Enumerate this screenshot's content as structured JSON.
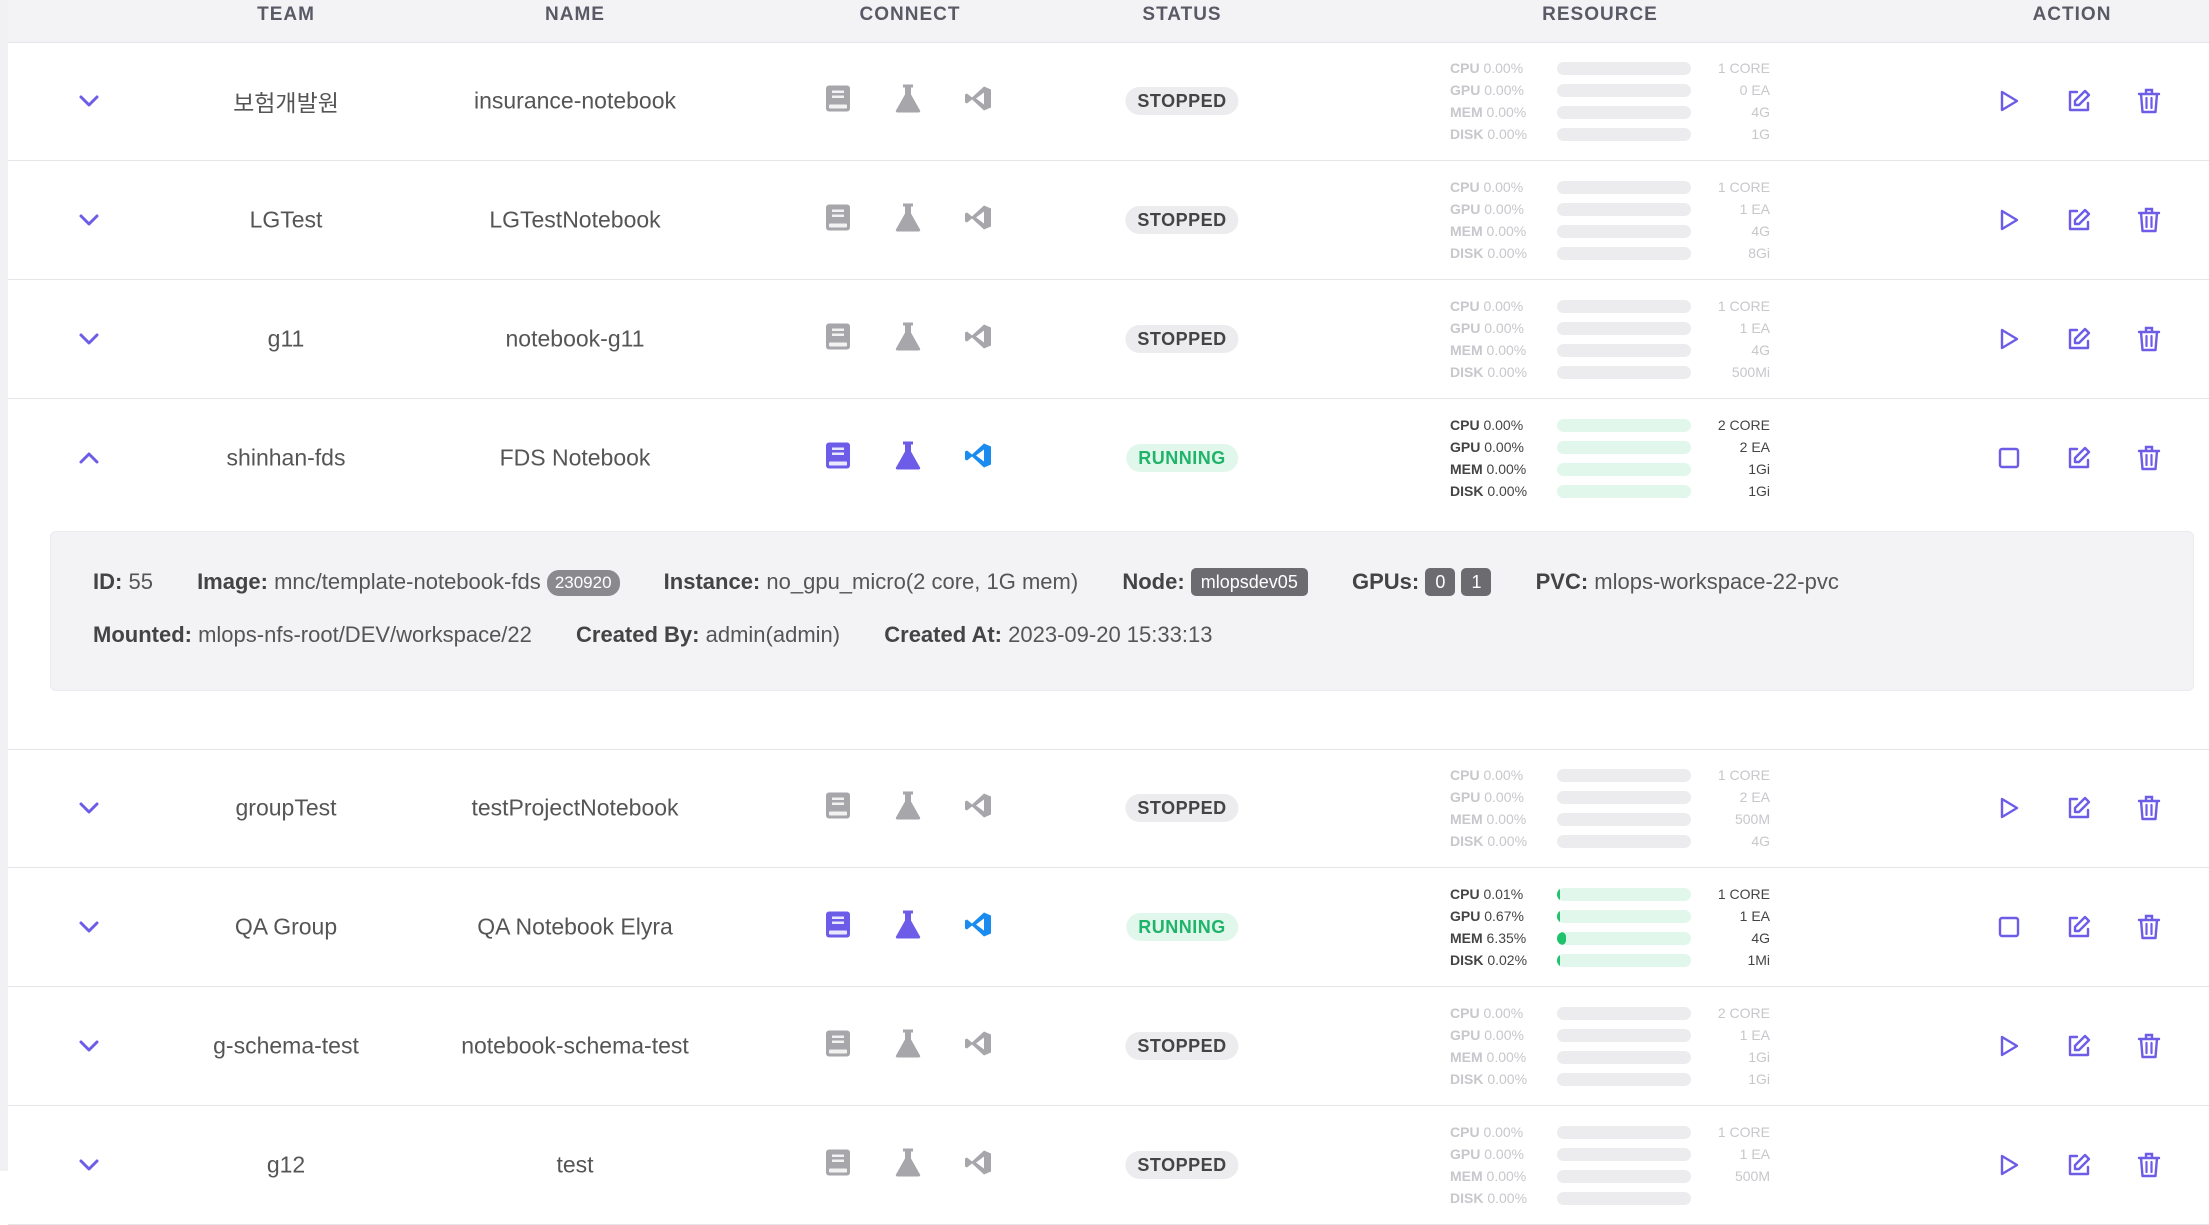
{
  "columns": {
    "team": "TEAM",
    "name": "NAME",
    "connect": "CONNECT",
    "status": "STATUS",
    "resource": "RESOURCE",
    "action": "ACTION"
  },
  "colors": {
    "accent": "#6c5ce7",
    "vscode": "#1a8cf0",
    "running": "#1fb46a",
    "muted": "#a6a6ab"
  },
  "rows": [
    {
      "team": "보험개발원",
      "name": "insurance-notebook",
      "status": "STOPPED",
      "expanded": false,
      "cpu": "CPU 0.00%",
      "gpu": "GPU 0.00%",
      "mem": "MEM 0.00%",
      "disk": "DISK 0.00%",
      "cpu_cap": "1 CORE",
      "gpu_cap": "0 EA",
      "mem_cap": "4G",
      "disk_cap": "1G",
      "cpu_usage": 0,
      "gpu_usage": 0,
      "mem_usage": 0,
      "disk_usage": 0
    },
    {
      "team": "LGTest",
      "name": "LGTestNotebook",
      "status": "STOPPED",
      "expanded": false,
      "cpu": "CPU 0.00%",
      "gpu": "GPU 0.00%",
      "mem": "MEM 0.00%",
      "disk": "DISK 0.00%",
      "cpu_cap": "1 CORE",
      "gpu_cap": "1 EA",
      "mem_cap": "4G",
      "disk_cap": "8Gi",
      "cpu_usage": 0,
      "gpu_usage": 0,
      "mem_usage": 0,
      "disk_usage": 0
    },
    {
      "team": "g11",
      "name": "notebook-g11",
      "status": "STOPPED",
      "expanded": false,
      "cpu": "CPU 0.00%",
      "gpu": "GPU 0.00%",
      "mem": "MEM 0.00%",
      "disk": "DISK 0.00%",
      "cpu_cap": "1 CORE",
      "gpu_cap": "1 EA",
      "mem_cap": "4G",
      "disk_cap": "500Mi",
      "cpu_usage": 0,
      "gpu_usage": 0,
      "mem_usage": 0,
      "disk_usage": 0
    },
    {
      "team": "shinhan-fds",
      "name": "FDS Notebook",
      "status": "RUNNING",
      "expanded": true,
      "cpu": "CPU 0.00%",
      "gpu": "GPU 0.00%",
      "mem": "MEM 0.00%",
      "disk": "DISK 0.00%",
      "cpu_cap": "2 CORE",
      "gpu_cap": "2 EA",
      "mem_cap": "1Gi",
      "disk_cap": "1Gi",
      "cpu_usage": 0,
      "gpu_usage": 0,
      "mem_usage": 0,
      "disk_usage": 0
    },
    {
      "team": "groupTest",
      "name": "testProjectNotebook",
      "status": "STOPPED",
      "expanded": false,
      "cpu": "CPU 0.00%",
      "gpu": "GPU 0.00%",
      "mem": "MEM 0.00%",
      "disk": "DISK 0.00%",
      "cpu_cap": "1 CORE",
      "gpu_cap": "2 EA",
      "mem_cap": "500M",
      "disk_cap": "4G",
      "cpu_usage": 0,
      "gpu_usage": 0,
      "mem_usage": 0,
      "disk_usage": 0
    },
    {
      "team": "QA Group",
      "name": "QA Notebook Elyra",
      "status": "RUNNING",
      "expanded": false,
      "cpu": "CPU 0.01%",
      "gpu": "GPU 0.67%",
      "mem": "MEM 6.35%",
      "disk": "DISK 0.02%",
      "cpu_cap": "1 CORE",
      "gpu_cap": "1 EA",
      "mem_cap": "4G",
      "disk_cap": "1Mi",
      "cpu_usage": 0.01,
      "gpu_usage": 0.67,
      "mem_usage": 6.35,
      "disk_usage": 0.02
    },
    {
      "team": "g-schema-test",
      "name": "notebook-schema-test",
      "status": "STOPPED",
      "expanded": false,
      "cpu": "CPU 0.00%",
      "gpu": "GPU 0.00%",
      "mem": "MEM 0.00%",
      "disk": "DISK 0.00%",
      "cpu_cap": "2 CORE",
      "gpu_cap": "1 EA",
      "mem_cap": "1Gi",
      "disk_cap": "1Gi",
      "cpu_usage": 0,
      "gpu_usage": 0,
      "mem_usage": 0,
      "disk_usage": 0
    },
    {
      "team": "g12",
      "name": "test",
      "status": "STOPPED",
      "expanded": false,
      "cpu": "CPU 0.00%",
      "gpu": "GPU 0.00%",
      "mem": "MEM 0.00%",
      "disk": "DISK 0.00%",
      "cpu_cap": "1 CORE",
      "gpu_cap": "1 EA",
      "mem_cap": "500M",
      "disk_cap": "",
      "cpu_usage": 0,
      "gpu_usage": 0,
      "mem_usage": 0,
      "disk_usage": 0
    }
  ],
  "detail": {
    "id_label": "ID:",
    "id": "55",
    "image_label": "Image:",
    "image": "mnc/template-notebook-fds",
    "image_tag": "230920",
    "instance_label": "Instance:",
    "instance": "no_gpu_micro(2 core, 1G mem)",
    "node_label": "Node:",
    "node": "mlopsdev05",
    "gpus_label": "GPUs:",
    "gpus": [
      "0",
      "1"
    ],
    "pvc_label": "PVC:",
    "pvc": "mlops-workspace-22-pvc",
    "mounted_label": "Mounted:",
    "mounted": "mlops-nfs-root/DEV/workspace/22",
    "created_by_label": "Created By:",
    "created_by": "admin(admin)",
    "created_at_label": "Created At:",
    "created_at": "2023-09-20 15:33:13"
  }
}
